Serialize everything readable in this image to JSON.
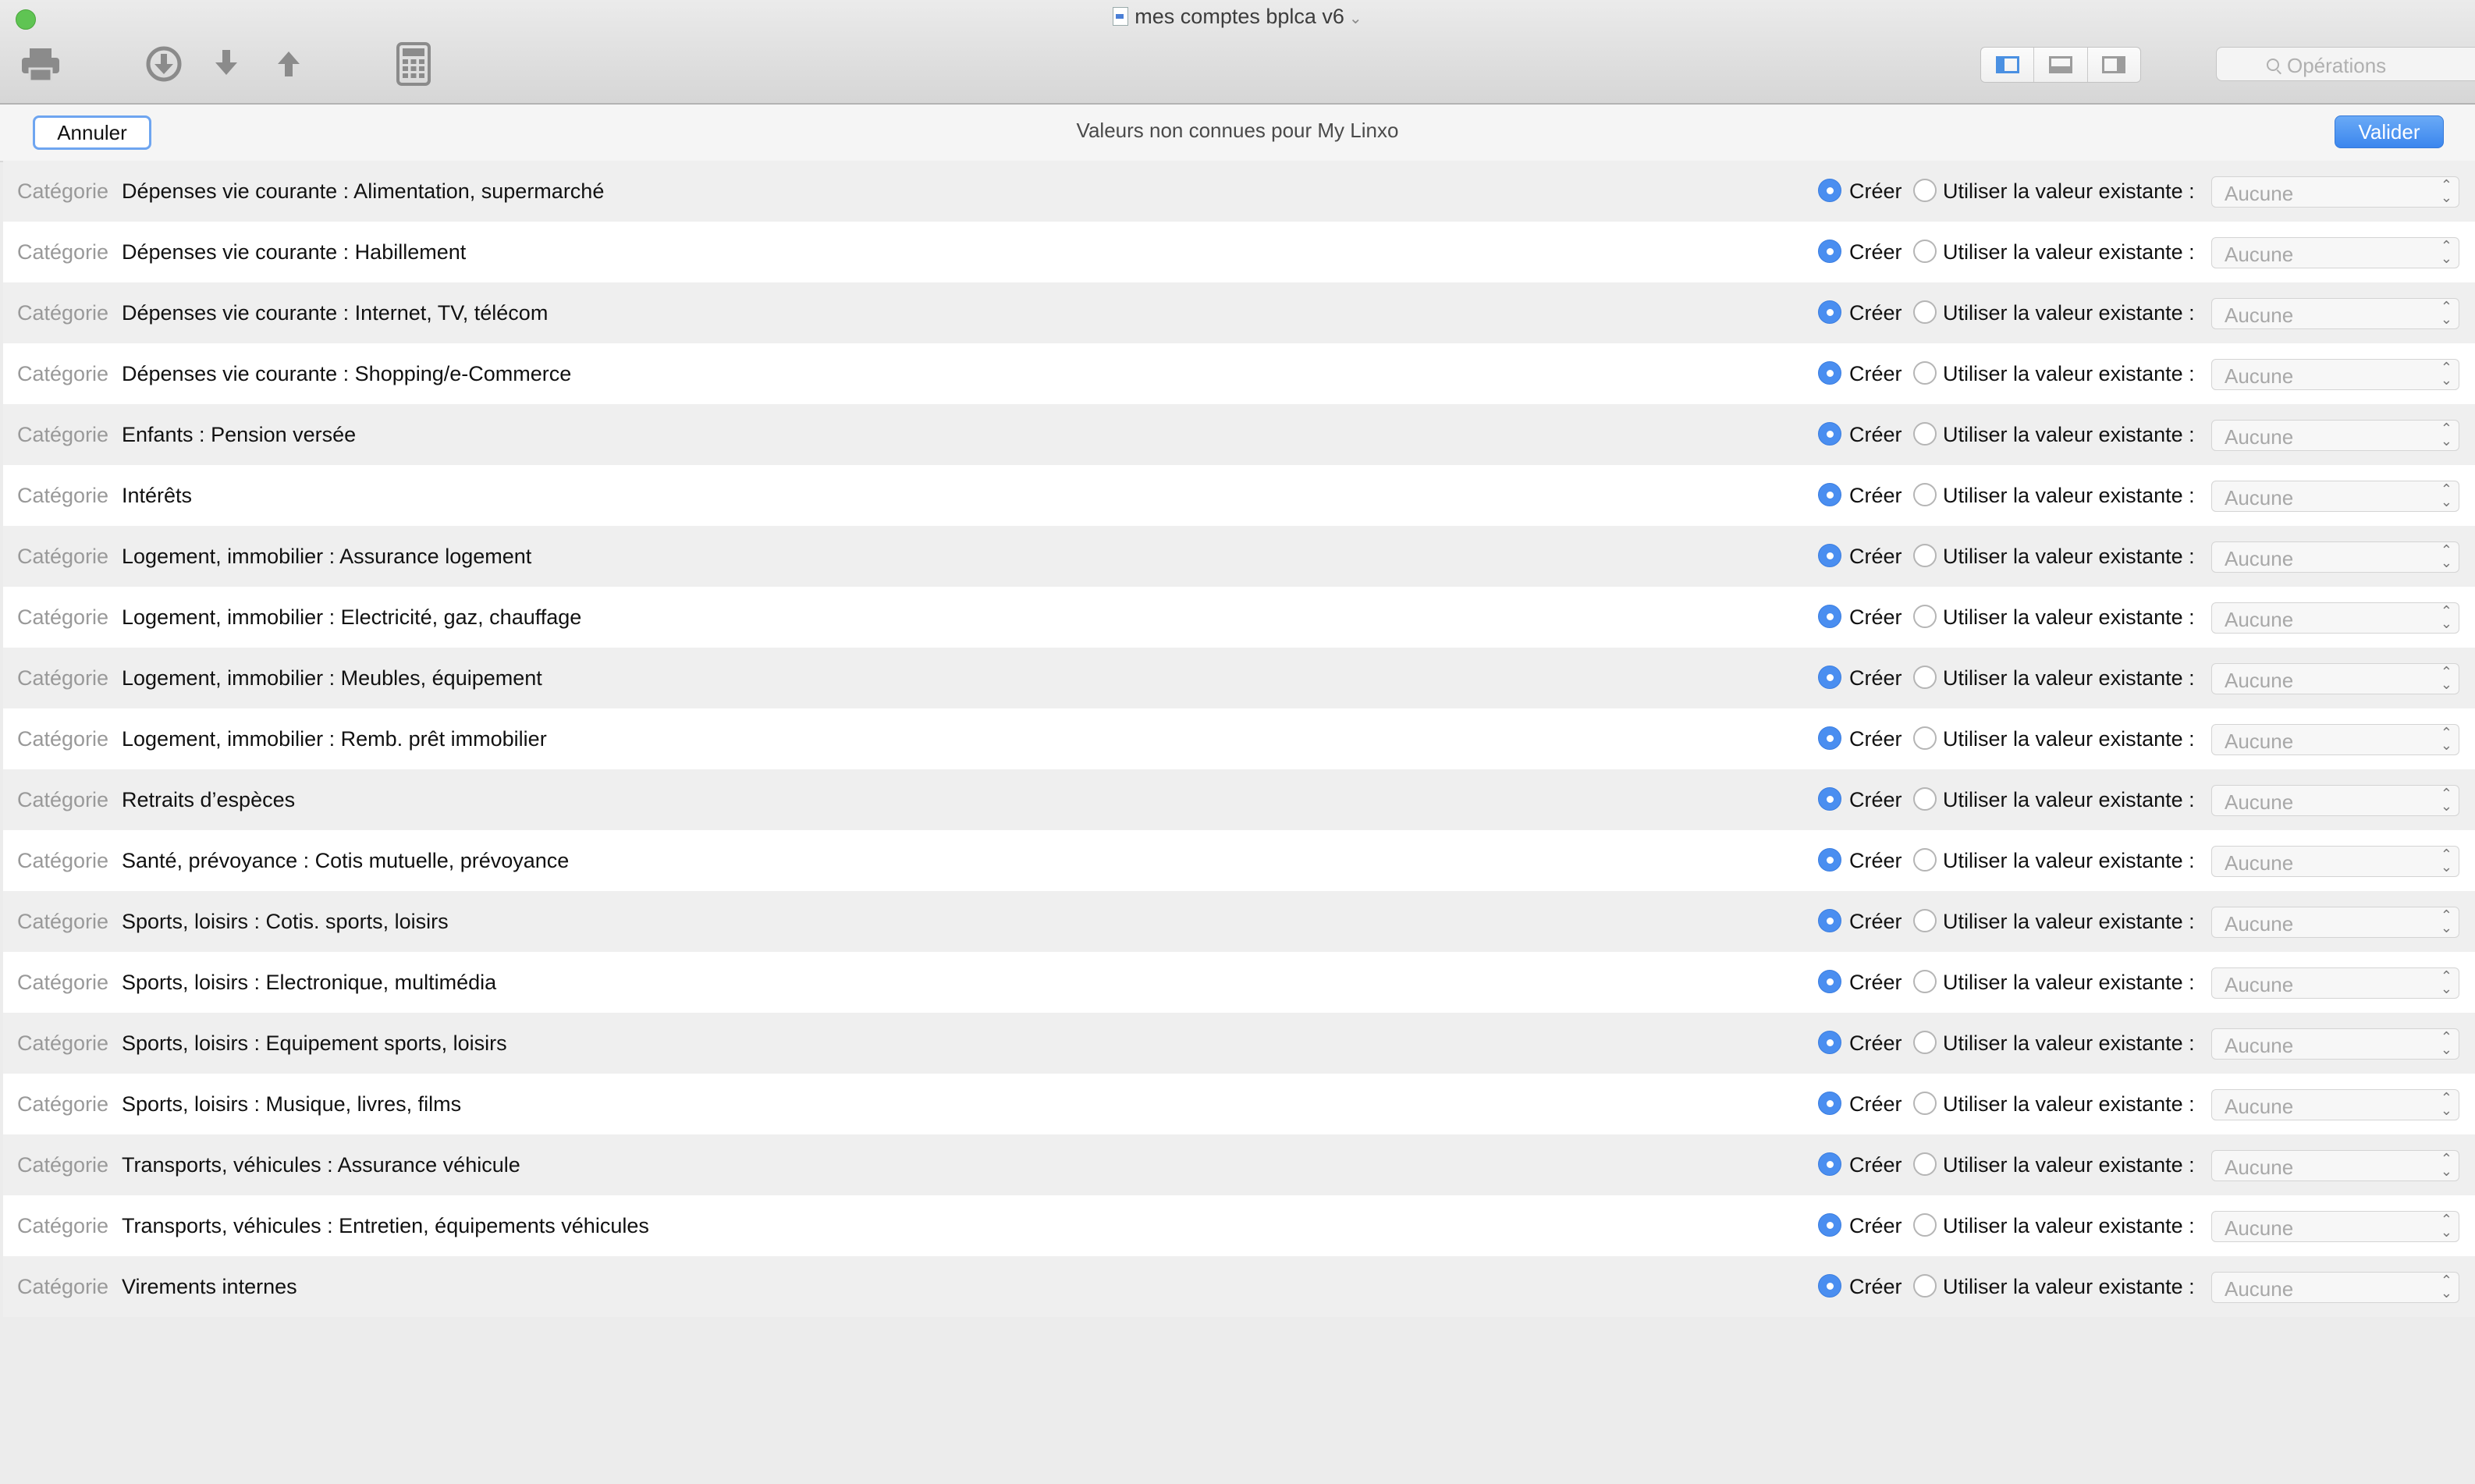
{
  "window": {
    "title": "mes comptes bplca v6"
  },
  "toolbar": {
    "search_placeholder": "Opérations",
    "icons": [
      "printer-icon",
      "download-circle-icon",
      "download-arrow-icon",
      "upload-arrow-icon",
      "calculator-icon"
    ],
    "view_segments": [
      "sidebar-left-icon",
      "panel-bottom-icon",
      "sidebar-right-icon"
    ]
  },
  "sheet": {
    "cancel_label": "Annuler",
    "title": "Valeurs non connues pour My Linxo",
    "ok_label": "Valider"
  },
  "row_template": {
    "kind": "Catégorie",
    "create_label": "Créer",
    "use_existing_label": "Utiliser la valeur existante :",
    "select_value": "Aucune"
  },
  "rows": [
    {
      "name": "Dépenses vie courante : Alimentation, supermarché"
    },
    {
      "name": "Dépenses vie courante : Habillement"
    },
    {
      "name": "Dépenses vie courante : Internet, TV, télécom"
    },
    {
      "name": "Dépenses vie courante : Shopping/e-Commerce"
    },
    {
      "name": "Enfants : Pension versée"
    },
    {
      "name": "Intérêts"
    },
    {
      "name": "Logement, immobilier : Assurance logement"
    },
    {
      "name": "Logement, immobilier : Electricité, gaz, chauffage"
    },
    {
      "name": "Logement, immobilier : Meubles, équipement"
    },
    {
      "name": "Logement, immobilier : Remb. prêt immobilier"
    },
    {
      "name": "Retraits d’espèces"
    },
    {
      "name": "Santé, prévoyance : Cotis mutuelle, prévoyance"
    },
    {
      "name": "Sports, loisirs : Cotis. sports, loisirs"
    },
    {
      "name": "Sports, loisirs : Electronique, multimédia"
    },
    {
      "name": "Sports, loisirs : Equipement sports, loisirs"
    },
    {
      "name": "Sports, loisirs : Musique, livres, films"
    },
    {
      "name": "Transports, véhicules : Assurance véhicule"
    },
    {
      "name": "Transports, véhicules : Entretien, équipements véhicules"
    },
    {
      "name": "Virements internes"
    }
  ]
}
